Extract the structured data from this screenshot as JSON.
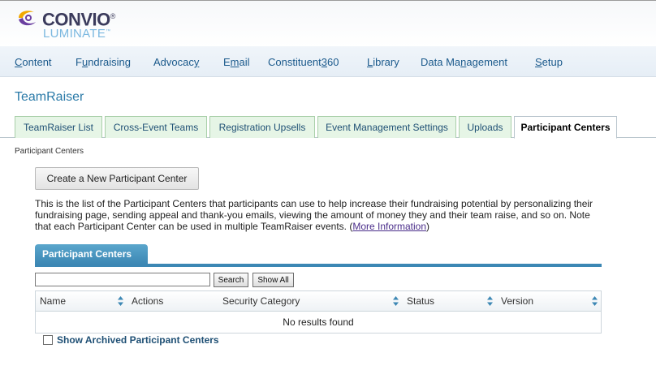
{
  "brand": {
    "name": "CONVIO",
    "product": "LUMINATE"
  },
  "nav": [
    {
      "label": "Content",
      "underline_char": "C"
    },
    {
      "label": "Fundraising",
      "underline_char": "u"
    },
    {
      "label": "Advocacy",
      "underline_char": "y"
    },
    {
      "label": "Email",
      "underline_char": "m"
    },
    {
      "label": "Constituent360",
      "underline_char": "3"
    },
    {
      "label": "Library",
      "underline_char": "L"
    },
    {
      "label": "Data Management",
      "underline_char": "n"
    },
    {
      "label": "Setup",
      "underline_char": "S"
    }
  ],
  "page_title": "TeamRaiser",
  "tabs": [
    {
      "label": "TeamRaiser List"
    },
    {
      "label": "Cross-Event Teams"
    },
    {
      "label": "Registration Upsells"
    },
    {
      "label": "Event Management Settings"
    },
    {
      "label": "Uploads"
    },
    {
      "label": "Participant Centers",
      "active": true
    }
  ],
  "breadcrumb": "Participant Centers",
  "create_button": "Create a New Participant Center",
  "description": {
    "text": "This is the list of the Participant Centers that participants can use to help increase their fundraising potential by personalizing their fundraising page, sending appeal and thank-you emails, viewing the amount of money they and their team raise, and so on. Note that each Participant Center can be used in multiple TeamRaiser events. (",
    "link": "More Information",
    "suffix": ")"
  },
  "panel_title": "Participant Centers",
  "search": {
    "value": "",
    "button": "Search",
    "show_all": "Show All"
  },
  "table": {
    "columns": [
      "Name",
      "Actions",
      "Security Category",
      "Status",
      "Version"
    ],
    "empty_text": "No results found"
  },
  "archive_label": "Show Archived Participant Centers",
  "colors": {
    "nav_text": "#1b5a8c",
    "tab_bg": "#e6f5e6",
    "panel_accent": "#3c87b4",
    "title": "#2a7aa8"
  },
  "icons": {
    "logo": "convio-swirl-icon",
    "sort": "sort-arrows-icon"
  }
}
